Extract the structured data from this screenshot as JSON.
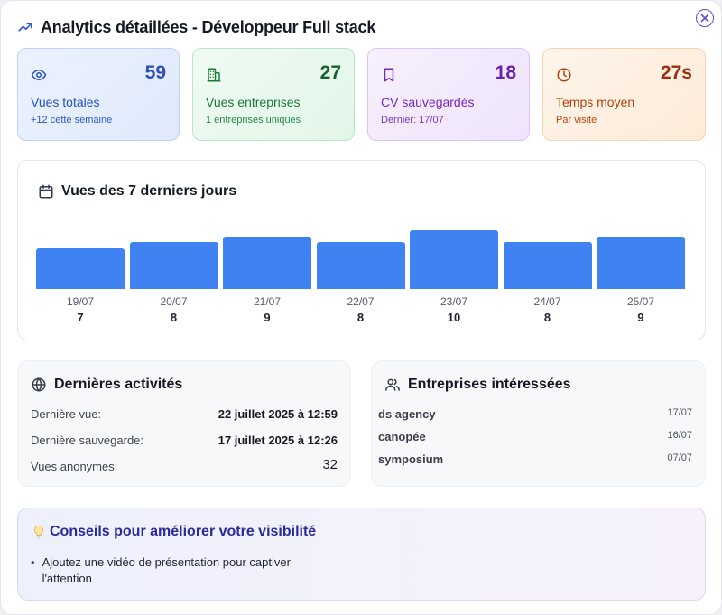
{
  "header": {
    "title": "Analytics détaillées - Développeur Full stack"
  },
  "stats": [
    {
      "icon": "eye-icon",
      "value": "59",
      "label": "Vues totales",
      "sub": "+12 cette semaine"
    },
    {
      "icon": "building-icon",
      "value": "27",
      "label": "Vues entreprises",
      "sub": "1 entreprises uniques"
    },
    {
      "icon": "bookmark-icon",
      "value": "18",
      "label": "CV sauvegardés",
      "sub": "Dernier: 17/07"
    },
    {
      "icon": "clock-icon",
      "value": "27s",
      "label": "Temps moyen",
      "sub": "Par visite"
    }
  ],
  "chart_data": {
    "type": "bar",
    "title": "Vues des 7 derniers jours",
    "categories": [
      "19/07",
      "20/07",
      "21/07",
      "22/07",
      "23/07",
      "24/07",
      "25/07"
    ],
    "values": [
      7,
      8,
      9,
      8,
      10,
      8,
      9
    ],
    "ylim": [
      0,
      10
    ],
    "grid": false,
    "color": "#3f82f2"
  },
  "activity": {
    "title": "Dernières activités",
    "rows": [
      {
        "label": "Dernière vue:",
        "value": "22 juillet 2025 à 12:59"
      },
      {
        "label": "Dernière sauvegarde:",
        "value": "17 juillet 2025 à 12:26"
      },
      {
        "label": "Vues anonymes:",
        "value": "32"
      }
    ]
  },
  "companies": {
    "title": "Entreprises intéressées",
    "items": [
      {
        "name": "ds agency",
        "date": "17/07"
      },
      {
        "name": "canopée",
        "date": "16/07"
      },
      {
        "name": "symposium",
        "date": "07/07"
      }
    ]
  },
  "tips": {
    "title": "Conseils pour améliorer votre visibilité",
    "items": [
      "Ajoutez une vidéo de présentation pour captiver l'attention"
    ]
  }
}
